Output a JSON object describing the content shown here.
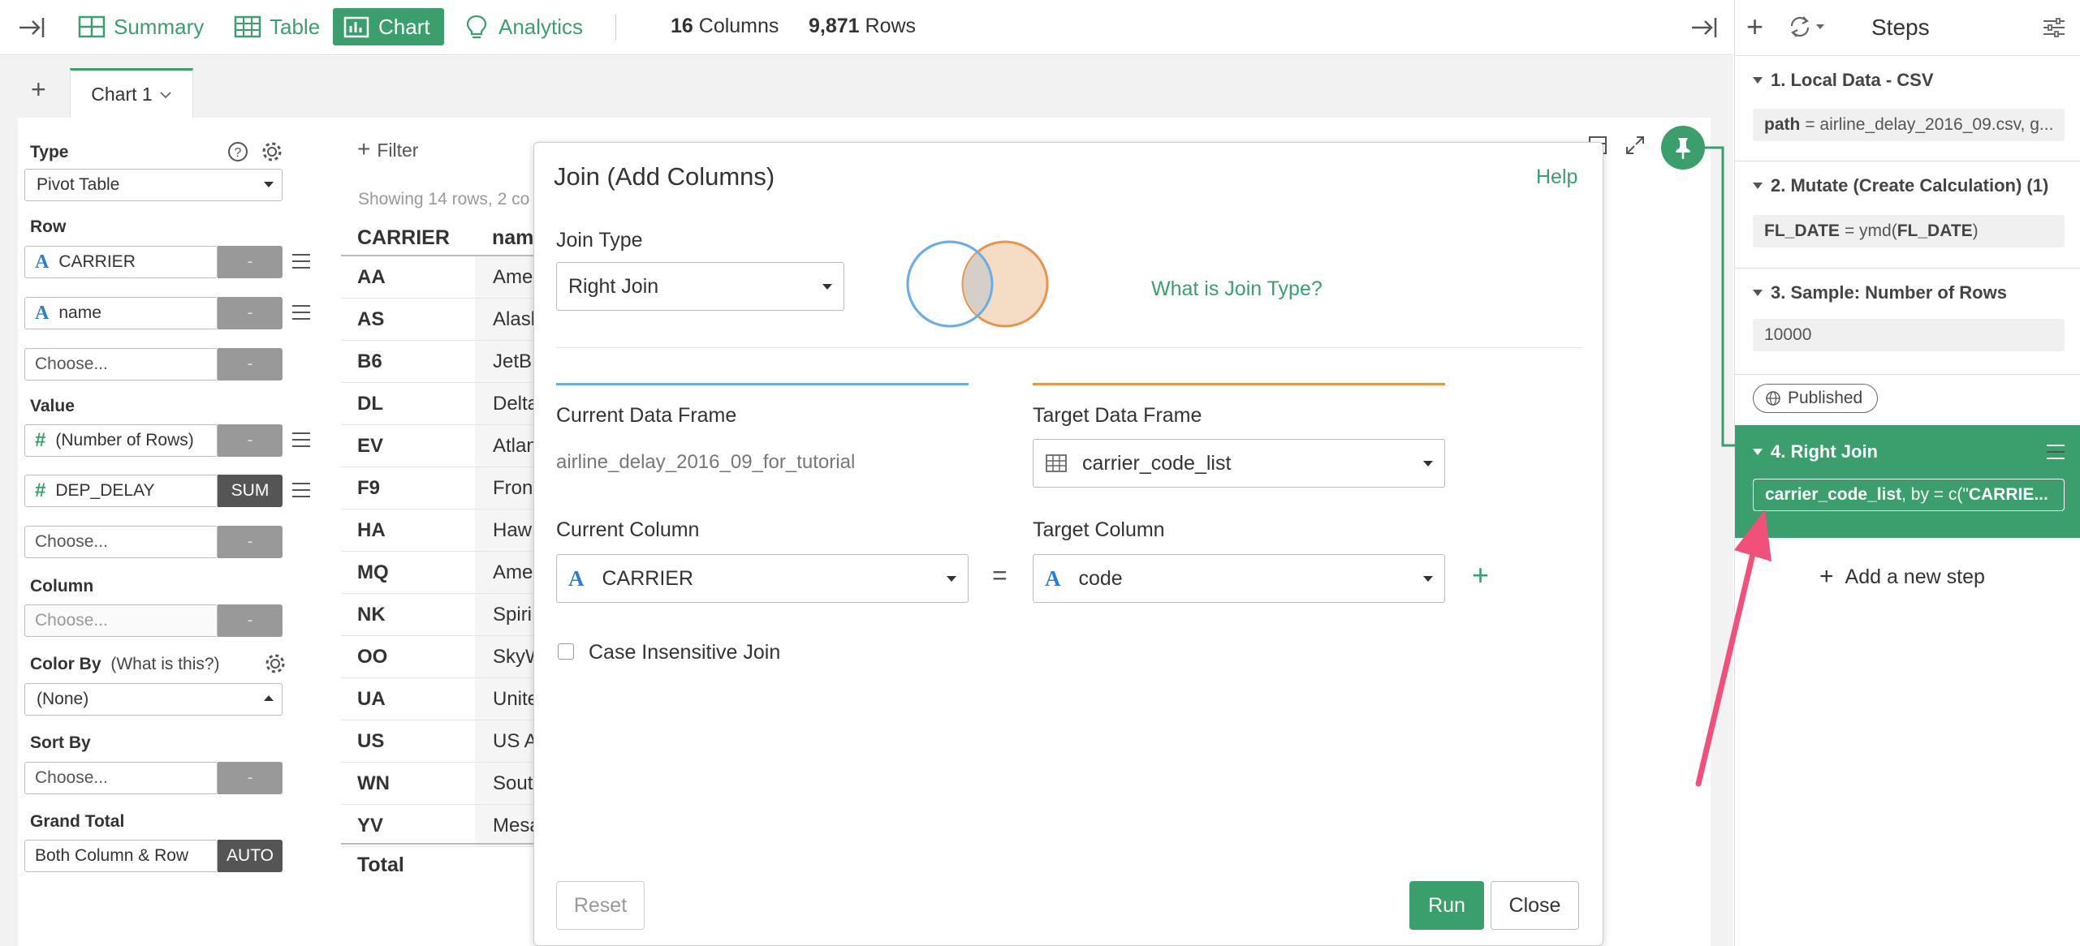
{
  "topbar": {
    "nav": [
      {
        "label": "Summary",
        "icon": "summary-icon"
      },
      {
        "label": "Table",
        "icon": "table-icon"
      },
      {
        "label": "Chart",
        "icon": "chart-icon",
        "active": true
      },
      {
        "label": "Analytics",
        "icon": "lightbulb-icon"
      }
    ],
    "columns_count": "16",
    "columns_label": "Columns",
    "rows_count": "9,871",
    "rows_label": "Rows"
  },
  "tabs": {
    "add": "+",
    "chart_tab": "Chart 1"
  },
  "config": {
    "type_label": "Type",
    "type_value": "Pivot Table",
    "row_label": "Row",
    "row_fields": [
      "CARRIER",
      "name"
    ],
    "choose": "Choose...",
    "dash": "-",
    "value_label": "Value",
    "value_fields": [
      {
        "name": "(Number of Rows)",
        "agg": "-"
      },
      {
        "name": "DEP_DELAY",
        "agg": "SUM"
      }
    ],
    "column_label": "Column",
    "color_label": "Color By",
    "color_hint": "(What is this?)",
    "color_value": "(None)",
    "sort_label": "Sort By",
    "grand_label": "Grand Total",
    "grand_value": "Both Column & Row",
    "grand_agg": "AUTO"
  },
  "pivot": {
    "filter": "Filter",
    "showing": "Showing 14 rows, 2 co",
    "header_carrier": "CARRIER",
    "header_name": "nam",
    "rows": [
      {
        "code": "AA",
        "name": "Ame"
      },
      {
        "code": "AS",
        "name": "Alask"
      },
      {
        "code": "B6",
        "name": "JetB"
      },
      {
        "code": "DL",
        "name": "Delta"
      },
      {
        "code": "EV",
        "name": "Atlan"
      },
      {
        "code": "F9",
        "name": "Fron"
      },
      {
        "code": "HA",
        "name": "Haw"
      },
      {
        "code": "MQ",
        "name": "Ame"
      },
      {
        "code": "NK",
        "name": "Spiri"
      },
      {
        "code": "OO",
        "name": "SkyW"
      },
      {
        "code": "UA",
        "name": "Unite"
      },
      {
        "code": "US",
        "name": "US A"
      },
      {
        "code": "WN",
        "name": "Sout"
      },
      {
        "code": "YV",
        "name": "Mesa"
      }
    ],
    "total": "Total"
  },
  "dialog": {
    "title": "Join (Add Columns)",
    "help": "Help",
    "join_type_label": "Join Type",
    "join_type_value": "Right Join",
    "what_is": "What is Join Type?",
    "current_df_label": "Current Data Frame",
    "current_df_value": "airline_delay_2016_09_for_tutorial",
    "target_df_label": "Target Data Frame",
    "target_df_value": "carrier_code_list",
    "current_col_label": "Current Column",
    "current_col_value": "CARRIER",
    "target_col_label": "Target Column",
    "target_col_value": "code",
    "equals": "=",
    "add": "+",
    "case_label": "Case Insensitive Join",
    "reset": "Reset",
    "run": "Run",
    "close": "Close",
    "colors": {
      "current": "#6aaee8",
      "target": "#e8944a"
    }
  },
  "steps": {
    "title": "Steps",
    "items": [
      {
        "title": "1. Local Data - CSV",
        "key": "path",
        "rest": " = airline_delay_2016_09.csv, g..."
      },
      {
        "title": "2. Mutate (Create Calculation) (1)",
        "key": "FL_DATE",
        "rest": " = ymd(",
        "key2": "FL_DATE",
        "rest2": ")"
      },
      {
        "title": "3. Sample: Number of Rows",
        "value": "10000"
      }
    ],
    "published": "Published",
    "active_title": "4. Right Join",
    "active_key": "carrier_code_list",
    "active_rest": ", by = c(\"",
    "active_key2": "CARRIE...",
    "add_step": "Add a new step"
  },
  "accent": "#3a9f6d",
  "arrow_color": "#f0507a"
}
